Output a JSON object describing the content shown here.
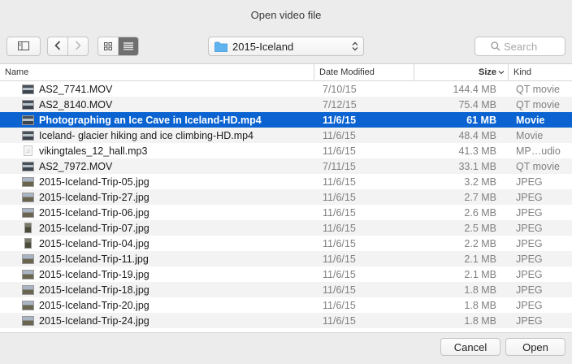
{
  "window": {
    "title": "Open video file"
  },
  "toolbar": {
    "sidebar_icon": "sidebar-icon",
    "back_icon": "chevron-left-icon",
    "forward_icon": "chevron-right-icon",
    "view_icon_grid": "grid-view-icon",
    "view_icon_list": "list-view-icon",
    "location": "2015-Iceland",
    "search_placeholder": "Search"
  },
  "columns": {
    "name": "Name",
    "date": "Date Modified",
    "size": "Size",
    "kind": "Kind"
  },
  "files": [
    {
      "name": "AS2_7741.MOV",
      "date": "7/10/15",
      "size": "144.4 MB",
      "kind": "QT movie",
      "icon": "video",
      "selected": false
    },
    {
      "name": "AS2_8140.MOV",
      "date": "7/12/15",
      "size": "75.4 MB",
      "kind": "QT movie",
      "icon": "video",
      "selected": false
    },
    {
      "name": "Photographing an Ice Cave in Iceland-HD.mp4",
      "date": "11/6/15",
      "size": "61 MB",
      "kind": "Movie",
      "icon": "video",
      "selected": true
    },
    {
      "name": "Iceland- glacier hiking and ice climbing-HD.mp4",
      "date": "11/6/15",
      "size": "48.4 MB",
      "kind": "Movie",
      "icon": "video",
      "selected": false
    },
    {
      "name": "vikingtales_12_hall.mp3",
      "date": "11/6/15",
      "size": "41.3 MB",
      "kind": "MP…udio",
      "icon": "audio",
      "selected": false
    },
    {
      "name": "AS2_7972.MOV",
      "date": "7/11/15",
      "size": "33.1 MB",
      "kind": "QT movie",
      "icon": "video",
      "selected": false
    },
    {
      "name": "2015-Iceland-Trip-05.jpg",
      "date": "11/6/15",
      "size": "3.2 MB",
      "kind": "JPEG",
      "icon": "photo",
      "selected": false
    },
    {
      "name": "2015-Iceland-Trip-27.jpg",
      "date": "11/6/15",
      "size": "2.7 MB",
      "kind": "JPEG",
      "icon": "photo",
      "selected": false
    },
    {
      "name": "2015-Iceland-Trip-06.jpg",
      "date": "11/6/15",
      "size": "2.6 MB",
      "kind": "JPEG",
      "icon": "photo",
      "selected": false
    },
    {
      "name": "2015-Iceland-Trip-07.jpg",
      "date": "11/6/15",
      "size": "2.5 MB",
      "kind": "JPEG",
      "icon": "portrait",
      "selected": false
    },
    {
      "name": "2015-Iceland-Trip-04.jpg",
      "date": "11/6/15",
      "size": "2.2 MB",
      "kind": "JPEG",
      "icon": "portrait",
      "selected": false
    },
    {
      "name": "2015-Iceland-Trip-11.jpg",
      "date": "11/6/15",
      "size": "2.1 MB",
      "kind": "JPEG",
      "icon": "photo",
      "selected": false
    },
    {
      "name": "2015-Iceland-Trip-19.jpg",
      "date": "11/6/15",
      "size": "2.1 MB",
      "kind": "JPEG",
      "icon": "photo",
      "selected": false
    },
    {
      "name": "2015-Iceland-Trip-18.jpg",
      "date": "11/6/15",
      "size": "1.8 MB",
      "kind": "JPEG",
      "icon": "photo",
      "selected": false
    },
    {
      "name": "2015-Iceland-Trip-20.jpg",
      "date": "11/6/15",
      "size": "1.8 MB",
      "kind": "JPEG",
      "icon": "photo",
      "selected": false
    },
    {
      "name": "2015-Iceland-Trip-24.jpg",
      "date": "11/6/15",
      "size": "1.8 MB",
      "kind": "JPEG",
      "icon": "photo",
      "selected": false
    }
  ],
  "footer": {
    "cancel_label": "Cancel",
    "open_label": "Open"
  },
  "colors": {
    "selection": "#0a63d1",
    "folder": "#5fb3ef"
  }
}
